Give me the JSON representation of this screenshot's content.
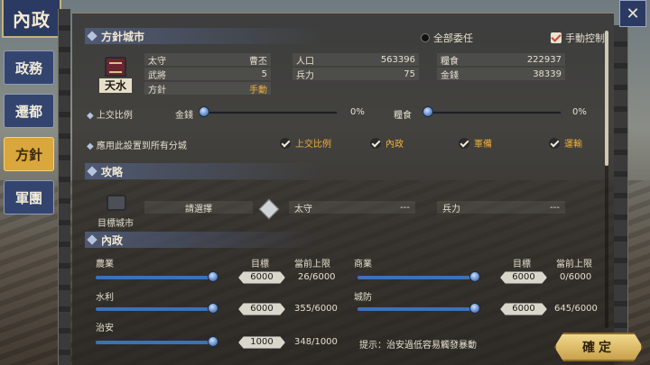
{
  "title_tab": "內政",
  "nav": [
    {
      "label": "政務",
      "active": false
    },
    {
      "label": "遷都",
      "active": false
    },
    {
      "label": "方針",
      "active": true
    },
    {
      "label": "軍團",
      "active": false
    }
  ],
  "close_icon": "✕",
  "policy_city": {
    "header": "方針城市",
    "delegate_all": "全部委任",
    "manual_control": "手動控制",
    "city_name": "天水",
    "stats": {
      "governor_label": "太守",
      "governor_value": "曹丕",
      "population_label": "人口",
      "population_value": "563396",
      "food_label": "糧食",
      "food_value": "222937",
      "officers_label": "武將",
      "officers_value": "5",
      "troops_label": "兵力",
      "troops_value": "75",
      "gold_label": "金錢",
      "gold_value": "38339",
      "policy_label": "方針",
      "policy_value": "手動"
    },
    "tribute_label": "上交比例",
    "gold_slider_label": "金錢",
    "gold_pct": "0%",
    "gold_fraction": 0,
    "food_slider_label": "糧食",
    "food_pct": "0%",
    "food_fraction": 0,
    "apply_label": "應用此設置到所有分城",
    "apply_options": [
      "上交比例",
      "內政",
      "軍備",
      "運輸"
    ]
  },
  "attack": {
    "header": "攻略",
    "target_city_label": "目標城市",
    "select_prompt": "請選擇",
    "governor_label": "太守",
    "governor_value": "---",
    "troops_label": "兵力",
    "troops_value": "---"
  },
  "internal": {
    "header": "內政",
    "target_col": "目標",
    "cap_col": "當前上限",
    "rows": [
      {
        "name": "農業",
        "target": "6000",
        "cap": "26/6000",
        "fraction": 1.0
      },
      {
        "name": "商業",
        "target": "6000",
        "cap": "0/6000",
        "fraction": 1.0
      },
      {
        "name": "水利",
        "target": "6000",
        "cap": "355/6000",
        "fraction": 1.0
      },
      {
        "name": "城防",
        "target": "6000",
        "cap": "645/6000",
        "fraction": 1.0
      },
      {
        "name": "治安",
        "target": "1000",
        "cap": "348/1000",
        "fraction": 1.0
      }
    ],
    "hint": "提示：治安過低容易觸發暴動"
  },
  "confirm_label": "確定"
}
